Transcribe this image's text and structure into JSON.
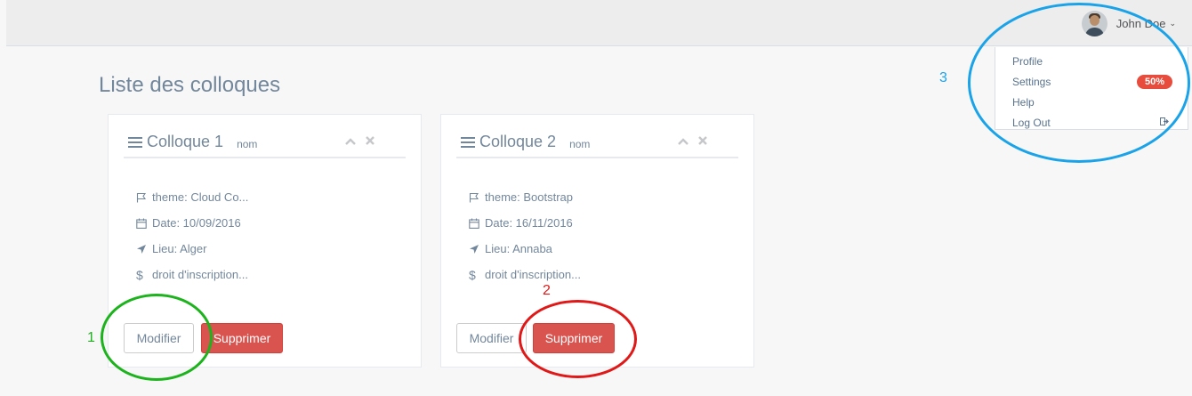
{
  "header": {
    "user_name": "John Doe",
    "chevron": "⌄",
    "avatar_icon": "user-avatar"
  },
  "user_menu": {
    "items": [
      {
        "label": "Profile"
      },
      {
        "label": "Settings",
        "badge": "50%"
      },
      {
        "label": "Help"
      },
      {
        "label": "Log Out",
        "icon": "sign-out-icon"
      }
    ]
  },
  "page": {
    "title": "Liste des colloques"
  },
  "panels": [
    {
      "title": "Colloque 1",
      "subtitle": "nom",
      "theme": "theme: Cloud Co...",
      "date": "Date: 10/09/2016",
      "lieu": "Lieu: Alger",
      "droit": "droit d'inscription...",
      "edit_label": "Modifier",
      "delete_label": "Supprimer"
    },
    {
      "title": "Colloque 2",
      "subtitle": "nom",
      "theme": "theme: Bootstrap",
      "date": "Date: 16/11/2016",
      "lieu": "Lieu: Annaba",
      "droit": "droit d'inscription...",
      "edit_label": "Modifier",
      "delete_label": "Supprimer"
    }
  ],
  "annotations": {
    "one": "1",
    "two": "2",
    "three": "3",
    "colors": {
      "green": "#1db31d",
      "red": "#e01818",
      "blue": "#1aa3e8"
    }
  }
}
